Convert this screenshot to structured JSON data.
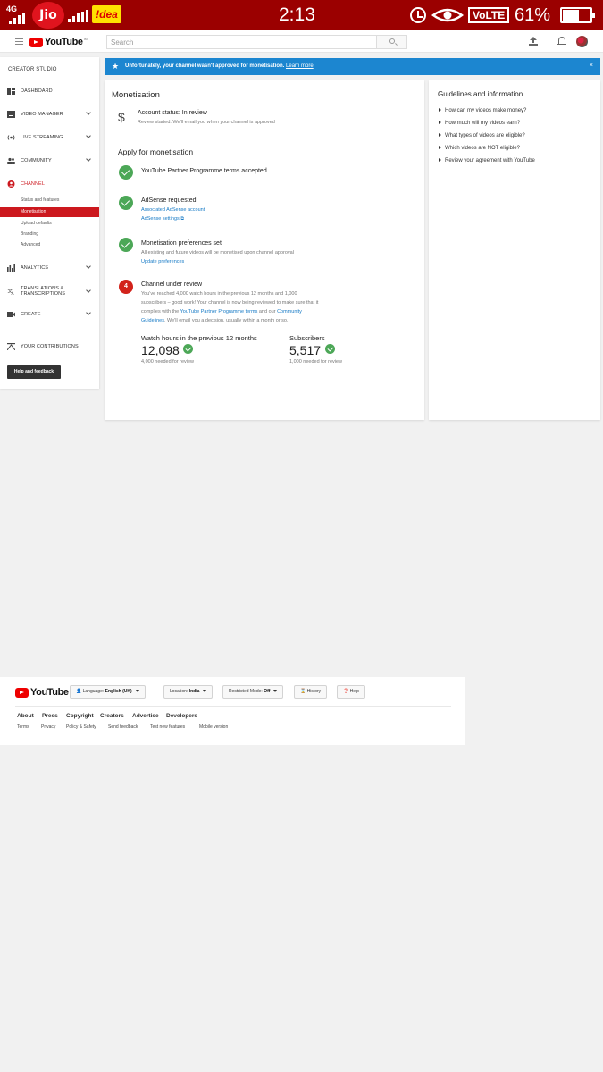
{
  "status_bar": {
    "network": "4G",
    "carrier1": "Jio",
    "carrier2": "!dea",
    "time": "2:13",
    "volte": "VoLTE",
    "battery_pct": "61%",
    "battery_level": 0.61
  },
  "header": {
    "logo_text": "YouTube",
    "logo_region": "IN",
    "search_placeholder": "Search"
  },
  "sidebar": {
    "title": "CREATOR STUDIO",
    "items": [
      {
        "label": "DASHBOARD"
      },
      {
        "label": "VIDEO MANAGER"
      },
      {
        "label": "LIVE STREAMING"
      },
      {
        "label": "COMMUNITY"
      },
      {
        "label": "CHANNEL"
      },
      {
        "label": "ANALYTICS"
      },
      {
        "label": "TRANSLATIONS & TRANSCRIPTIONS"
      },
      {
        "label": "CREATE"
      },
      {
        "label": "YOUR CONTRIBUTIONS"
      }
    ],
    "channel_sub": [
      {
        "label": "Status and features"
      },
      {
        "label": "Monetisation"
      },
      {
        "label": "Upload defaults"
      },
      {
        "label": "Branding"
      },
      {
        "label": "Advanced"
      }
    ],
    "help_button": "Help and feedback"
  },
  "banner": {
    "message": "Unfortunately, your channel wasn't approved for monetisation.",
    "link": "Learn more",
    "close": "×"
  },
  "main": {
    "title": "Monetisation",
    "account_status": "Account status: In review",
    "account_sub": "Review started. We'll email you when your channel is approved",
    "apply_title": "Apply for monetisation",
    "steps": [
      {
        "title": "YouTube Partner Programme terms accepted"
      },
      {
        "title": "AdSense requested",
        "link1": "Associated AdSense account",
        "link2": "AdSense settings"
      },
      {
        "title": "Monetisation preferences set",
        "desc": "All existing and future videos will be monetised upon channel approval",
        "link1": "Update preferences"
      },
      {
        "number": "4",
        "title": "Channel under review",
        "desc_a": "You've reached 4,000 watch hours in the previous 12 months and 1,000",
        "desc_b": "subscribers – good work! Your channel is now being reviewed to make sure that it",
        "desc_c1": "complies with the ",
        "desc_link1": "YouTube Partner Programme terms",
        "desc_c2": " and our ",
        "desc_link2": "Community",
        "desc_link3": "Guidelines",
        "desc_c3": ". We'll email you a decision, usually within a month or so."
      }
    ],
    "watch_hours": {
      "label": "Watch hours in the previous 12 months",
      "value": "12,098",
      "needed": "4,000 needed for review"
    },
    "subscribers": {
      "label": "Subscribers",
      "value": "5,517",
      "needed": "1,000 needed for review"
    }
  },
  "guidelines": {
    "title": "Guidelines and information",
    "items": [
      "How can my videos make money?",
      "How much will my videos earn?",
      "What types of videos are eligible?",
      "Which videos are NOT eligible?",
      "Review your agreement with YouTube"
    ]
  },
  "footer": {
    "language_label": "Language:",
    "language_value": "English (UK)",
    "location_label": "Location:",
    "location_value": "India",
    "restricted_label": "Restricted Mode:",
    "restricted_value": "Off",
    "history": "History",
    "help": "Help",
    "links": [
      "About",
      "Press",
      "Copyright",
      "Creators",
      "Advertise",
      "Developers"
    ],
    "links2": [
      "Terms",
      "Privacy",
      "Policy & Safety",
      "Send feedback",
      "Test new features",
      "Mobile version"
    ]
  }
}
